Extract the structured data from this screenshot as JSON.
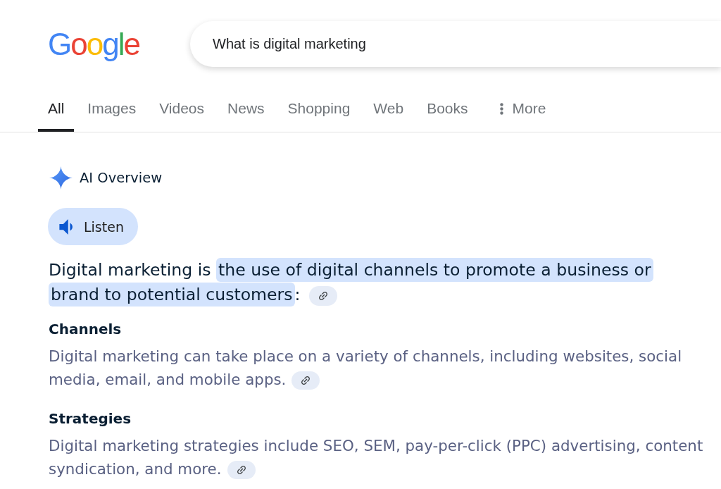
{
  "header": {
    "logo": {
      "letters": [
        {
          "char": "G",
          "color": "#4285f4"
        },
        {
          "char": "o",
          "color": "#ea4335"
        },
        {
          "char": "o",
          "color": "#fbbc05"
        },
        {
          "char": "g",
          "color": "#4285f4"
        },
        {
          "char": "l",
          "color": "#34a853"
        },
        {
          "char": "e",
          "color": "#ea4335"
        }
      ]
    },
    "search": {
      "value": "What is digital marketing"
    }
  },
  "tabs": [
    {
      "label": "All",
      "selected": true,
      "kind": "link"
    },
    {
      "label": "Images",
      "selected": false,
      "kind": "link"
    },
    {
      "label": "Videos",
      "selected": false,
      "kind": "link"
    },
    {
      "label": "News",
      "selected": false,
      "kind": "link"
    },
    {
      "label": "Shopping",
      "selected": false,
      "kind": "link"
    },
    {
      "label": "Web",
      "selected": false,
      "kind": "link"
    },
    {
      "label": "Books",
      "selected": false,
      "kind": "link"
    },
    {
      "label": "More",
      "selected": false,
      "kind": "menu"
    }
  ],
  "ai_overview": {
    "title": "AI Overview",
    "listen_button": {
      "label": "Listen"
    },
    "summary": {
      "segments": [
        {
          "text": "Digital marketing is ",
          "highlighted": false
        },
        {
          "text": "the use of digital channels to promote a business or brand to potential customers",
          "highlighted": true
        },
        {
          "text": ":",
          "highlighted": false
        }
      ],
      "cited": true
    },
    "sections": [
      {
        "heading": "Channels",
        "text": "Digital marketing can take place on a variety of channels, including websites, social media, email, and mobile apps.",
        "cited": true
      },
      {
        "heading": "Strategies",
        "text": "Digital marketing strategies include SEO, SEM, pay-per-click (PPC) advertising, content syndication, and more.",
        "cited": true
      }
    ]
  }
}
